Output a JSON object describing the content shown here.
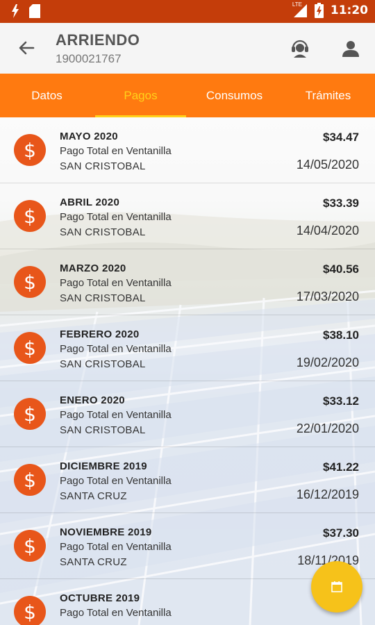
{
  "status_bar": {
    "time": "11:20",
    "network": "LTE"
  },
  "header": {
    "title": "ARRIENDO",
    "account": "1900021767"
  },
  "tabs": [
    {
      "label": "Datos",
      "active": false
    },
    {
      "label": "Pagos",
      "active": true
    },
    {
      "label": "Consumos",
      "active": false
    },
    {
      "label": "Trámites",
      "active": false
    }
  ],
  "payments": [
    {
      "month": "MAYO 2020",
      "description": "Pago Total en Ventanilla",
      "place": "SAN CRISTOBAL",
      "amount": "$34.47",
      "date": "14/05/2020"
    },
    {
      "month": "ABRIL 2020",
      "description": "Pago Total en Ventanilla",
      "place": "SAN CRISTOBAL",
      "amount": "$33.39",
      "date": "14/04/2020"
    },
    {
      "month": "MARZO 2020",
      "description": "Pago Total en Ventanilla",
      "place": "SAN CRISTOBAL",
      "amount": "$40.56",
      "date": "17/03/2020"
    },
    {
      "month": "FEBRERO 2020",
      "description": "Pago Total en Ventanilla",
      "place": "SAN CRISTOBAL",
      "amount": "$38.10",
      "date": "19/02/2020"
    },
    {
      "month": "ENERO 2020",
      "description": "Pago Total en Ventanilla",
      "place": "SAN CRISTOBAL",
      "amount": "$33.12",
      "date": "22/01/2020"
    },
    {
      "month": "DICIEMBRE 2019",
      "description": "Pago Total en Ventanilla",
      "place": "SANTA CRUZ",
      "amount": "$41.22",
      "date": "16/12/2019"
    },
    {
      "month": "NOVIEMBRE 2019",
      "description": "Pago Total en Ventanilla",
      "place": "SANTA CRUZ",
      "amount": "$37.30",
      "date": "18/11/2019"
    },
    {
      "month": "OCTUBRE 2019",
      "description": "Pago Total en Ventanilla",
      "place": "",
      "amount": "",
      "date": ""
    }
  ],
  "icons": {
    "back": "arrow-back-icon",
    "support": "support-agent-icon",
    "user": "person-icon",
    "coin": "dollar-coin-icon",
    "fab": "calendar-icon"
  },
  "colors": {
    "status_bar": "#c43d0a",
    "tab_bar": "#ff7a10",
    "tab_active": "#ffd21a",
    "coin": "#e8561a",
    "fab": "#f6c21a"
  }
}
